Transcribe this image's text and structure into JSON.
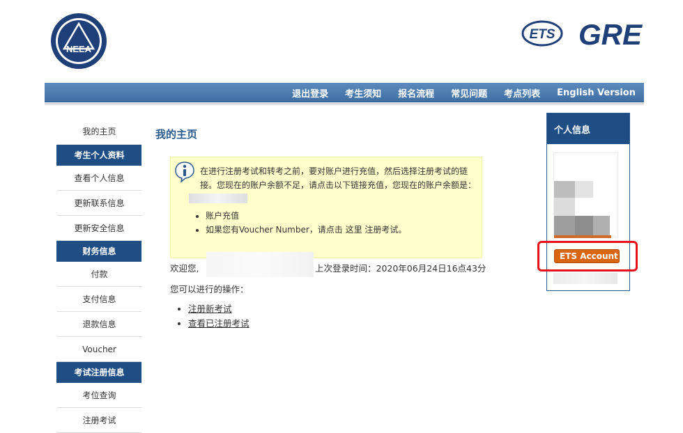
{
  "brand": {
    "left_logo_text": "NEEA",
    "ets_text": "ETS",
    "gre_text": "GRE"
  },
  "topnav": [
    "退出登录",
    "考生须知",
    "报名流程",
    "常见问题",
    "考点列表",
    "English Version"
  ],
  "sidebar": {
    "home": "我的主页",
    "sections": [
      {
        "title": "考生个人资料",
        "links": [
          "查看个人信息",
          "更新联系信息",
          "更新安全信息"
        ]
      },
      {
        "title": "财务信息",
        "links": [
          "付款",
          "支付信息",
          "退款信息",
          "Voucher"
        ]
      },
      {
        "title": "考试注册信息",
        "links": [
          "考位查询",
          "注册考试"
        ]
      }
    ]
  },
  "main": {
    "title": "我的主页",
    "notice": {
      "message": "在进行注册考试和转考之前，要对账户进行充值，然后选择注册考试的链接。您现在的账户余额不足，请点击以下链接充值，您现在的账户余额是：",
      "items": [
        "账户充值",
        "如果您有Voucher Number，请点击 这里 注册考试。"
      ]
    },
    "welcome": "欢迎您,",
    "last_login": "上次登录时间：2020年06月24日16点43分",
    "ops_title": "您可以进行的操作：",
    "ops": [
      "注册新考试",
      "查看已注册考试"
    ]
  },
  "right_panel": {
    "title": "个人信息",
    "ets_button": "ETS Account"
  },
  "colors": {
    "nav_blue": "#3f6fa3",
    "dark_blue": "#1f4e85",
    "notice_yellow": "#ffffcc",
    "ets_orange": "#d9660f",
    "highlight_red": "#e8121a"
  }
}
